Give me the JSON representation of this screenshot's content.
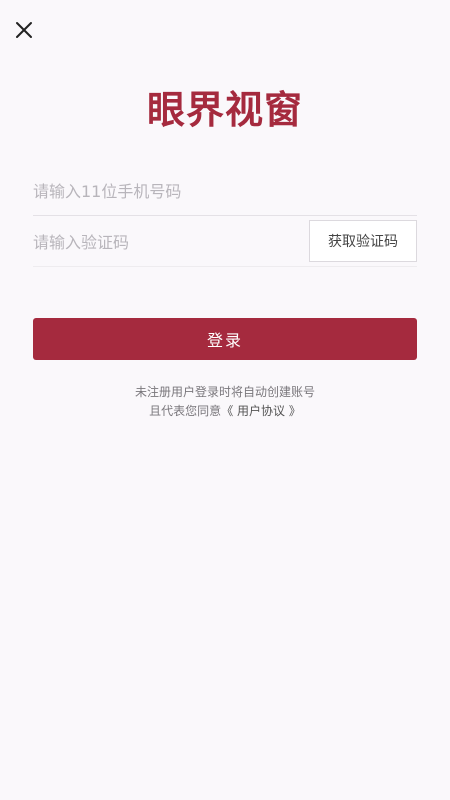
{
  "colors": {
    "brand": "#a52a3e",
    "background": "#faf8fb"
  },
  "header": {
    "close_icon": "close-icon"
  },
  "logo": {
    "text": "眼界视窗"
  },
  "form": {
    "phone_placeholder": "请输入11位手机号码",
    "phone_value": "",
    "code_placeholder": "请输入验证码",
    "code_value": "",
    "get_code_label": "获取验证码"
  },
  "login": {
    "label": "登录"
  },
  "notice": {
    "line1": "未注册用户登录时将自动创建账号",
    "line2_prefix": "且代表您同意",
    "agreement_link": "《 用户协议 》"
  }
}
